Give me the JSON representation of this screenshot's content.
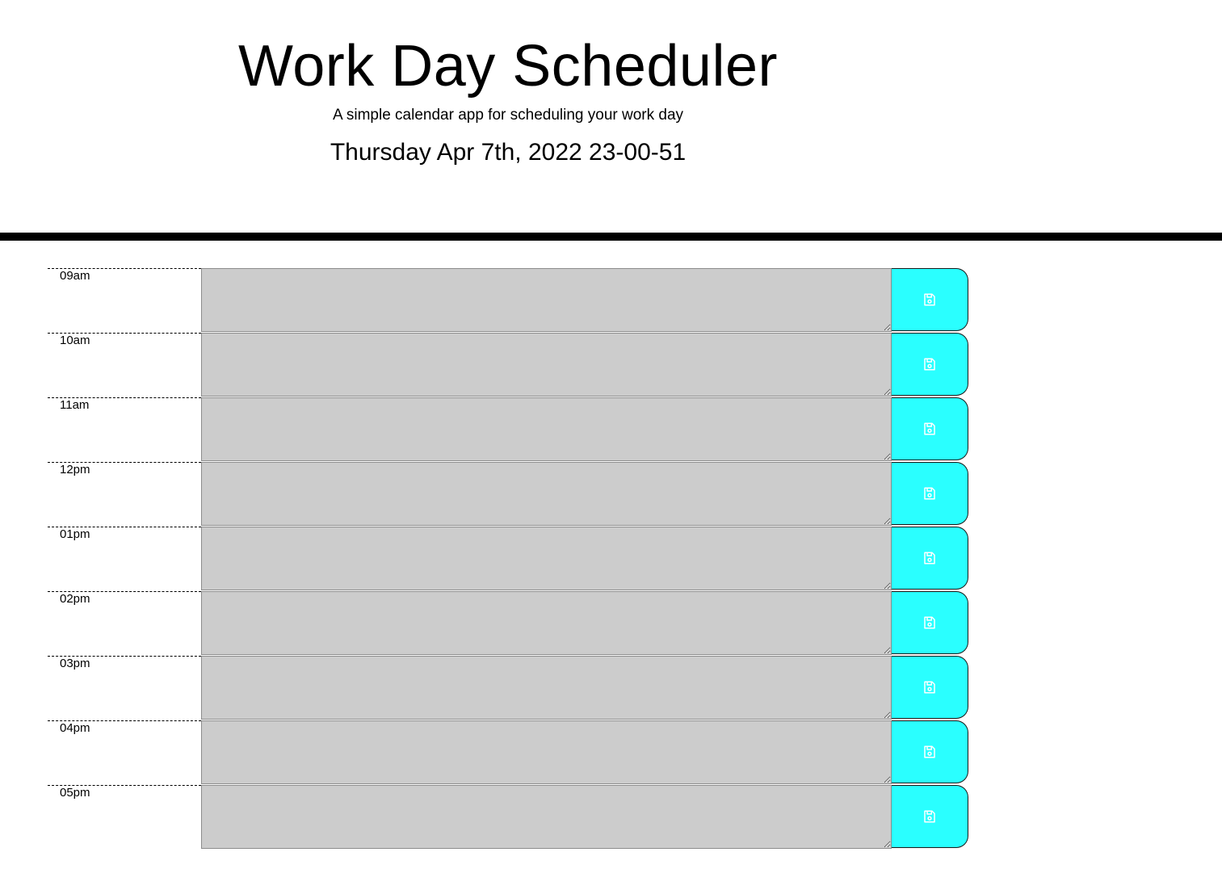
{
  "header": {
    "title": "Work Day Scheduler",
    "lead": "A simple calendar app for scheduling your work day",
    "current_day": "Thursday Apr 7th, 2022 23-00-51"
  },
  "timeblocks": [
    {
      "hour": "09am",
      "description": "",
      "save_icon": "save-icon"
    },
    {
      "hour": "10am",
      "description": "",
      "save_icon": "save-icon"
    },
    {
      "hour": "11am",
      "description": "",
      "save_icon": "save-icon"
    },
    {
      "hour": "12pm",
      "description": "",
      "save_icon": "save-icon"
    },
    {
      "hour": "01pm",
      "description": "",
      "save_icon": "save-icon"
    },
    {
      "hour": "02pm",
      "description": "",
      "save_icon": "save-icon"
    },
    {
      "hour": "03pm",
      "description": "",
      "save_icon": "save-icon"
    },
    {
      "hour": "04pm",
      "description": "",
      "save_icon": "save-icon"
    },
    {
      "hour": "05pm",
      "description": "",
      "save_icon": "save-icon"
    }
  ],
  "colors": {
    "past_block": "#cccccc",
    "save_button": "#2affff",
    "divider": "#000000"
  }
}
